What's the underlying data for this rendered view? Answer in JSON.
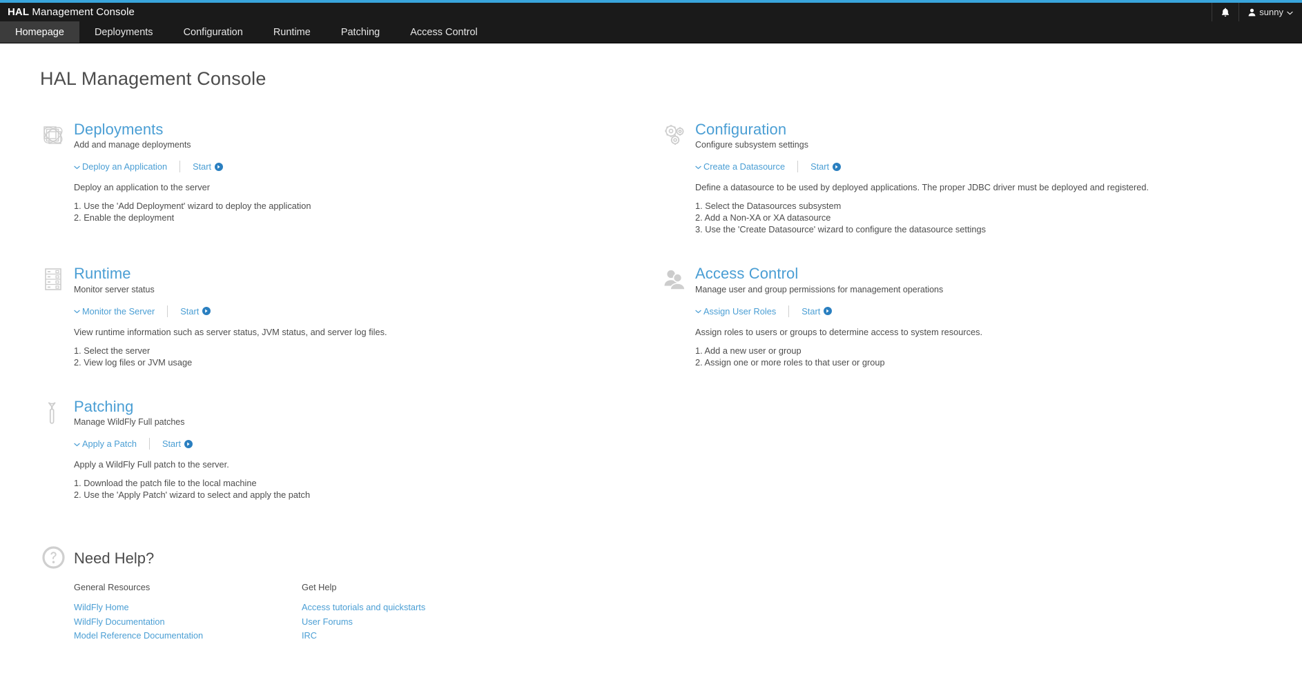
{
  "header": {
    "brand": "HAL",
    "title_rest": " Management Console",
    "notification_icon": "bell-icon",
    "user_icon": "user-icon",
    "user_name": "sunny",
    "user_chevron": "chevron-down-icon"
  },
  "tabs": [
    {
      "label": "Homepage",
      "active": true
    },
    {
      "label": "Deployments",
      "active": false
    },
    {
      "label": "Configuration",
      "active": false
    },
    {
      "label": "Runtime",
      "active": false
    },
    {
      "label": "Patching",
      "active": false
    },
    {
      "label": "Access Control",
      "active": false
    }
  ],
  "page": {
    "title": "HAL Management Console"
  },
  "colors": {
    "accent_bar": "#39a5dc",
    "link_blue": "#4a9ed4",
    "header_bg": "#1a1a1a",
    "tab_active_bg": "#3c3c3c",
    "body_text": "#4d4d4d",
    "icon_gray": "#cccccc"
  },
  "sections": [
    {
      "id": "deployments",
      "icon": "deployments-icon",
      "title": "Deployments",
      "subtitle": "Add and manage deployments",
      "toggle_label": "Deploy an Application",
      "start_label": "Start",
      "description": "Deploy an application to the server",
      "steps": [
        "1. Use the 'Add Deployment' wizard to deploy the application",
        "2. Enable the deployment"
      ]
    },
    {
      "id": "configuration",
      "icon": "gears-icon",
      "title": "Configuration",
      "subtitle": "Configure subsystem settings",
      "toggle_label": "Create a Datasource",
      "start_label": "Start",
      "description": "Define a datasource to be used by deployed applications. The proper JDBC driver must be deployed and registered.",
      "steps": [
        "1. Select the Datasources subsystem",
        "2. Add a Non-XA or XA datasource",
        "3. Use the 'Create Datasource' wizard to configure the datasource settings"
      ]
    },
    {
      "id": "runtime",
      "icon": "server-rack-icon",
      "title": "Runtime",
      "subtitle": "Monitor server status",
      "toggle_label": "Monitor the Server",
      "start_label": "Start",
      "description": "View runtime information such as server status, JVM status, and server log files.",
      "steps": [
        "1. Select the server",
        "2. View log files or JVM usage"
      ]
    },
    {
      "id": "access-control",
      "icon": "users-icon",
      "title": "Access Control",
      "subtitle": "Manage user and group permissions for management operations",
      "toggle_label": "Assign User Roles",
      "start_label": "Start",
      "description": "Assign roles to users or groups to determine access to system resources.",
      "steps": [
        "1. Add a new user or group",
        "2. Assign one or more roles to that user or group"
      ]
    },
    {
      "id": "patching",
      "icon": "wrench-icon",
      "title": "Patching",
      "subtitle": "Manage WildFly Full patches",
      "toggle_label": "Apply a Patch",
      "start_label": "Start",
      "description": "Apply a WildFly Full patch to the server.",
      "steps": [
        "1. Download the patch file to the local machine",
        "2. Use the 'Apply Patch' wizard to select and apply the patch"
      ]
    }
  ],
  "help": {
    "icon": "question-mark-icon",
    "title": "Need Help?",
    "columns": [
      {
        "title": "General Resources",
        "links": [
          "WildFly Home",
          "WildFly Documentation",
          "Model Reference Documentation"
        ]
      },
      {
        "title": "Get Help",
        "links": [
          "Access tutorials and quickstarts",
          "User Forums",
          "IRC"
        ]
      }
    ]
  }
}
